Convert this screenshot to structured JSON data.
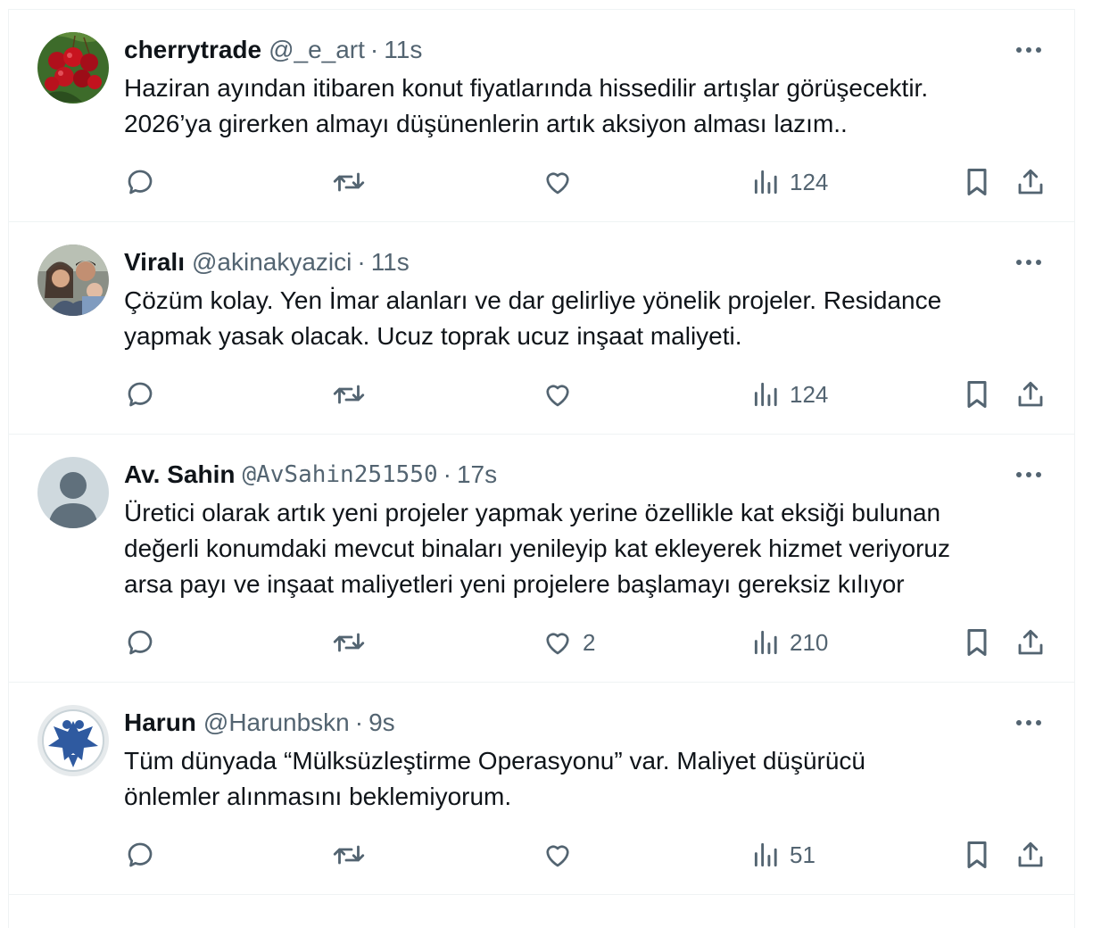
{
  "tweets": [
    {
      "name": "cherrytrade",
      "handle": "@_e_art",
      "separator": "·",
      "time": "11s",
      "lines": [
        "Haziran ayından itibaren konut fiyatlarında hissedilir artışlar görüşecektir.",
        "2026’ya girerken almayı düşünenlerin artık aksiyon alması lazım.."
      ],
      "likes": "",
      "views": "124",
      "avatar_icon": "cherries-photo"
    },
    {
      "name": "Viralı",
      "handle": "@akinakyazici",
      "separator": "·",
      "time": "11s",
      "lines": [
        "Çözüm kolay. Yen İmar alanları ve dar gelirliye yönelik projeler. Residance",
        "yapmak yasak olacak. Ucuz toprak ucuz inşaat maliyeti."
      ],
      "likes": "",
      "views": "124",
      "avatar_icon": "family-photo"
    },
    {
      "name": "Av. Sahin",
      "handle": "@AvSahin251550",
      "separator": "·",
      "time": "17s",
      "lines": [
        "Üretici olarak artık yeni projeler yapmak yerine  özellikle kat eksiği bulunan",
        "değerli konumdaki mevcut binaları yenileyip kat ekleyerek hizmet veriyoruz",
        "arsa payı ve inşaat maliyetleri yeni projelere başlamayı gereksiz kılıyor"
      ],
      "likes": "2",
      "views": "210",
      "avatar_icon": "default-profile"
    },
    {
      "name": "Harun",
      "handle": "@Harunbskn",
      "separator": "·",
      "time": "9s",
      "lines": [
        "Tüm dünyada “Mülksüzleştirme Operasyonu” var. Maliyet düşürücü",
        "önlemler alınmasını beklemiyorum."
      ],
      "likes": "",
      "views": "51",
      "avatar_icon": "double-headed-eagle-emblem"
    }
  ],
  "colors": {
    "text": "#0f1419",
    "secondary": "#536471",
    "border": "#eff3f4"
  }
}
